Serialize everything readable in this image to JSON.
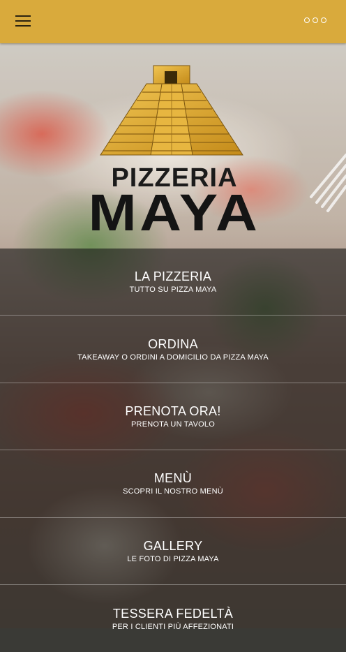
{
  "app": {
    "colors": {
      "topbar": "#d9aa3c",
      "logo_gold": "#e4ad2f",
      "text_dark": "#141414"
    }
  },
  "topbar": {
    "menu_icon": "hamburger-icon",
    "more_icon": "more-dots-icon"
  },
  "logo": {
    "line1": "PIZZERIA",
    "line2": "MAYA",
    "icon": "pyramid-icon"
  },
  "menu": {
    "items": [
      {
        "title": "LA PIZZERIA",
        "subtitle": "TUTTO SU PIZZA MAYA"
      },
      {
        "title": "ORDINA",
        "subtitle": "TAKEAWAY O ORDINI A DOMICILIO DA PIZZA MAYA"
      },
      {
        "title": "PRENOTA ORA!",
        "subtitle": "PRENOTA UN TAVOLO"
      },
      {
        "title": "MENÙ",
        "subtitle": "SCOPRI IL NOSTRO MENÙ"
      },
      {
        "title": "GALLERY",
        "subtitle": "LE FOTO DI PIZZA MAYA"
      },
      {
        "title": "TESSERA FEDELTÀ",
        "subtitle": "PER I CLIENTI PIÙ AFFEZIONATI"
      }
    ]
  }
}
